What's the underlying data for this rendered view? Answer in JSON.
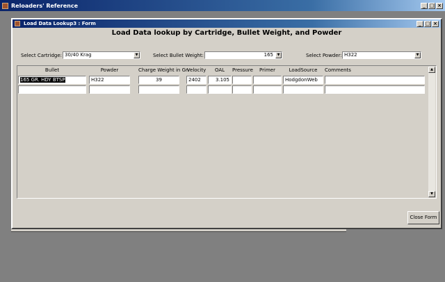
{
  "app": {
    "title": "Reloaders' Reference"
  },
  "form": {
    "title": "Load Data Lookup3 : Form",
    "heading": "Load Data lookup by Cartridge, Bullet Weight, and Powder",
    "cartridge": {
      "label": "Select Cartridge:",
      "value": "30/40 Krag"
    },
    "bullet_weight": {
      "label": "Select Bullet Weight:",
      "value": "165"
    },
    "powder": {
      "label": "Select Powder:",
      "value": "H322"
    },
    "columns": [
      "Bullet",
      "Powder",
      "Charge Weight in Gn",
      "Velocity",
      "OAL",
      "Pressure",
      "Primer",
      "LoadSource",
      "Comments"
    ],
    "rows": [
      [
        "165 GR. HDY BTSP",
        "H322",
        "39",
        "2402",
        "3.105",
        "",
        "",
        "HodgdonWeb",
        ""
      ],
      [
        "",
        "",
        "",
        "",
        "",
        "",
        "",
        "",
        ""
      ]
    ],
    "close_label": "Close Form"
  },
  "window_buttons": {
    "min": "_",
    "max": "□",
    "close": "×"
  }
}
